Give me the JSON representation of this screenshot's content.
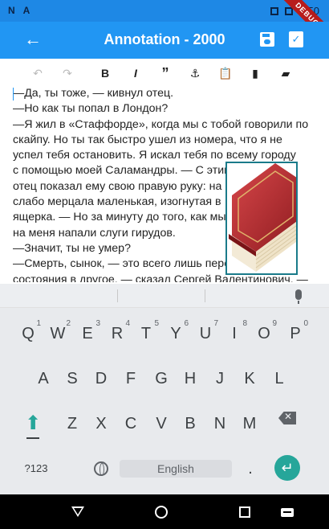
{
  "status": {
    "time": "2:50",
    "left_icons": [
      "N",
      "A"
    ]
  },
  "debug_banner": "DEBUG",
  "appbar": {
    "title": "Annotation - 2000"
  },
  "toolbar": {
    "bold": "B",
    "italic": "I",
    "quote": "”"
  },
  "text_lines": [
    "—Да, ты тоже, — кивнул отец.",
    "—Но как ты попал в Лондон?",
    "—Я жил в «Стаффорде», когда мы с тобой говорили по",
    "скайпу. Но ты так быстро ушел из номера, что я не",
    "успел тебя остановить. Я искал тебя по всему городу",
    "с помощью моей Саламандры. — С этими сл",
    "отец показал ему свою правую руку: на",
    "слабо мерцала маленькая, изогнутая в",
    "ящерка. — Но за минуту до того, как мы",
    "на меня напали слуги гирудов.",
    "—Значит, ты не умер?",
    "—Смерть, сынок, — это всего лишь пере",
    "состояния в другое, — сказал Сергей Валентинович. —"
  ],
  "keyboard": {
    "row1": [
      {
        "k": "Q",
        "n": "1"
      },
      {
        "k": "W",
        "n": "2"
      },
      {
        "k": "E",
        "n": "3"
      },
      {
        "k": "R",
        "n": "4"
      },
      {
        "k": "T",
        "n": "5"
      },
      {
        "k": "Y",
        "n": "6"
      },
      {
        "k": "U",
        "n": "7"
      },
      {
        "k": "I",
        "n": "8"
      },
      {
        "k": "O",
        "n": "9"
      },
      {
        "k": "P",
        "n": "0"
      }
    ],
    "row2": [
      "A",
      "S",
      "D",
      "F",
      "G",
      "H",
      "J",
      "K",
      "L"
    ],
    "row3": [
      "Z",
      "X",
      "C",
      "V",
      "B",
      "N",
      "M"
    ],
    "symbols_label": "?123",
    "space_label": "English",
    "period": "."
  },
  "colors": {
    "appbar": "#2196f3",
    "statusbar": "#1e88e5",
    "accent": "#26a69a"
  }
}
